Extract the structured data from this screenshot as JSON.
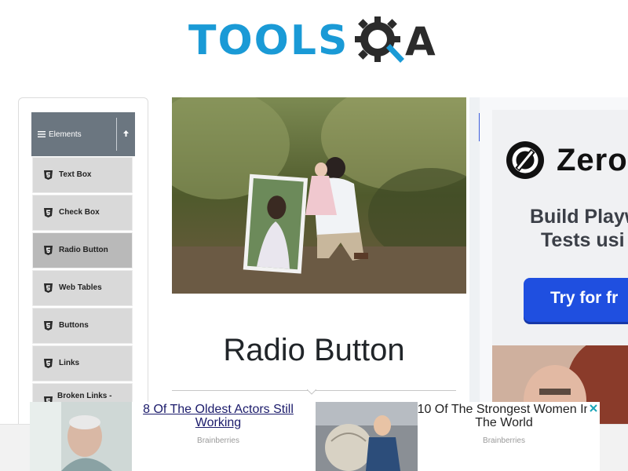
{
  "logo": {
    "word": "TOOLS",
    "mark": "A",
    "icon": "gear-magnifier-icon"
  },
  "sidebar": {
    "group_label": "Elements",
    "items": [
      {
        "label": "Text Box"
      },
      {
        "label": "Check Box"
      },
      {
        "label": "Radio Button",
        "active": true
      },
      {
        "label": "Web Tables"
      },
      {
        "label": "Buttons"
      },
      {
        "label": "Links"
      },
      {
        "label": "Broken Links -"
      }
    ]
  },
  "main": {
    "title": "Radio Button"
  },
  "right_ad": {
    "brand": "Zero",
    "line1": "Build Playw",
    "line2": "Tests usi",
    "cta": "Try for fr"
  },
  "bottom_ads": [
    {
      "title": "8 Of The Oldest Actors Still Working",
      "source": "Brainberries"
    },
    {
      "title": "10 Of The Strongest Women In The World",
      "source": "Brainberries"
    }
  ],
  "colors": {
    "logo_blue": "#1a9ad6",
    "sidebar_header": "#6b7680",
    "nav_item": "#d9d9d9",
    "nav_active": "#b9b9b9",
    "cta_blue": "#1f4fe0"
  }
}
